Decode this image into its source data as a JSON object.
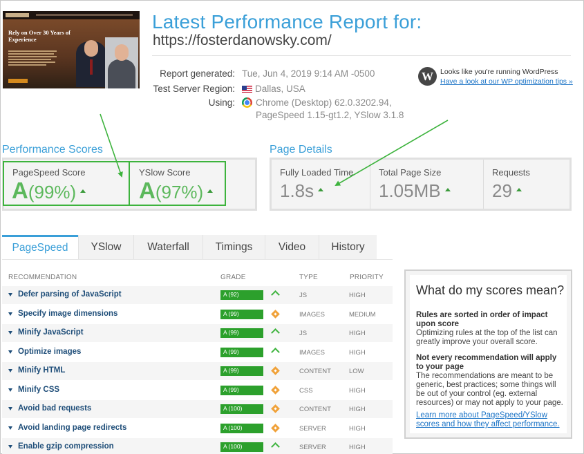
{
  "thumbnail": {
    "headline": "Rely on Over 30 Years of Experience"
  },
  "header": {
    "title": "Latest Performance Report for:",
    "url": "https://fosterdanowsky.com/"
  },
  "report": {
    "generated_label": "Report generated:",
    "generated_value": "Tue, Jun 4, 2019 9:14 AM -0500",
    "region_label": "Test Server Region:",
    "region_value": "Dallas, USA",
    "using_label": "Using:",
    "using_value_1": "Chrome (Desktop) 62.0.3202.94,",
    "using_value_2": "PageSpeed 1.15-gt1.2, YSlow 3.1.8"
  },
  "wordpress": {
    "icon": "wordpress-icon",
    "text": "Looks like you're running WordPress",
    "link": "Have a look at our WP optimization tips »"
  },
  "performance_scores": {
    "title": "Performance Scores",
    "pagespeed_label": "PageSpeed Score",
    "pagespeed_grade": "A",
    "pagespeed_pct": "(99%)",
    "yslow_label": "YSlow Score",
    "yslow_grade": "A",
    "yslow_pct": "(97%)"
  },
  "page_details": {
    "title": "Page Details",
    "load_label": "Fully Loaded Time",
    "load_value": "1.8s",
    "size_label": "Total Page Size",
    "size_value": "1.05MB",
    "requests_label": "Requests",
    "requests_value": "29"
  },
  "tabs": [
    "PageSpeed",
    "YSlow",
    "Waterfall",
    "Timings",
    "Video",
    "History"
  ],
  "table": {
    "headers": [
      "RECOMMENDATION",
      "GRADE",
      "TYPE",
      "PRIORITY"
    ],
    "rows": [
      {
        "name": "Defer parsing of JavaScript",
        "grade": "A (92)",
        "trend": "up",
        "type": "JS",
        "priority": "HIGH"
      },
      {
        "name": "Specify image dimensions",
        "grade": "A (99)",
        "trend": "neutral",
        "type": "IMAGES",
        "priority": "MEDIUM"
      },
      {
        "name": "Minify JavaScript",
        "grade": "A (99)",
        "trend": "up",
        "type": "JS",
        "priority": "HIGH"
      },
      {
        "name": "Optimize images",
        "grade": "A (99)",
        "trend": "up",
        "type": "IMAGES",
        "priority": "HIGH"
      },
      {
        "name": "Minify HTML",
        "grade": "A (99)",
        "trend": "neutral",
        "type": "CONTENT",
        "priority": "LOW"
      },
      {
        "name": "Minify CSS",
        "grade": "A (99)",
        "trend": "neutral",
        "type": "CSS",
        "priority": "HIGH"
      },
      {
        "name": "Avoid bad requests",
        "grade": "A (100)",
        "trend": "neutral",
        "type": "CONTENT",
        "priority": "HIGH"
      },
      {
        "name": "Avoid landing page redirects",
        "grade": "A (100)",
        "trend": "neutral",
        "type": "SERVER",
        "priority": "HIGH"
      },
      {
        "name": "Enable gzip compression",
        "grade": "A (100)",
        "trend": "up",
        "type": "SERVER",
        "priority": "HIGH"
      }
    ]
  },
  "panel": {
    "title": "What do my scores mean?",
    "rule1_title": "Rules are sorted in order of impact upon score",
    "rule1_text": "Optimizing rules at the top of the list can greatly improve your overall score.",
    "rule2_title": "Not every recommendation will apply to your page",
    "rule2_text": "The recommendations are meant to be generic, best practices; some things will be out of your control (eg. external resources) or may not apply to your page.",
    "link": "Learn more about PageSpeed/YSlow scores and how they affect performance."
  },
  "colors": {
    "accent": "#3a9fd8",
    "grade_green": "#5cb85c",
    "bar_green": "#2ca02c",
    "highlight": "#3db33d"
  }
}
